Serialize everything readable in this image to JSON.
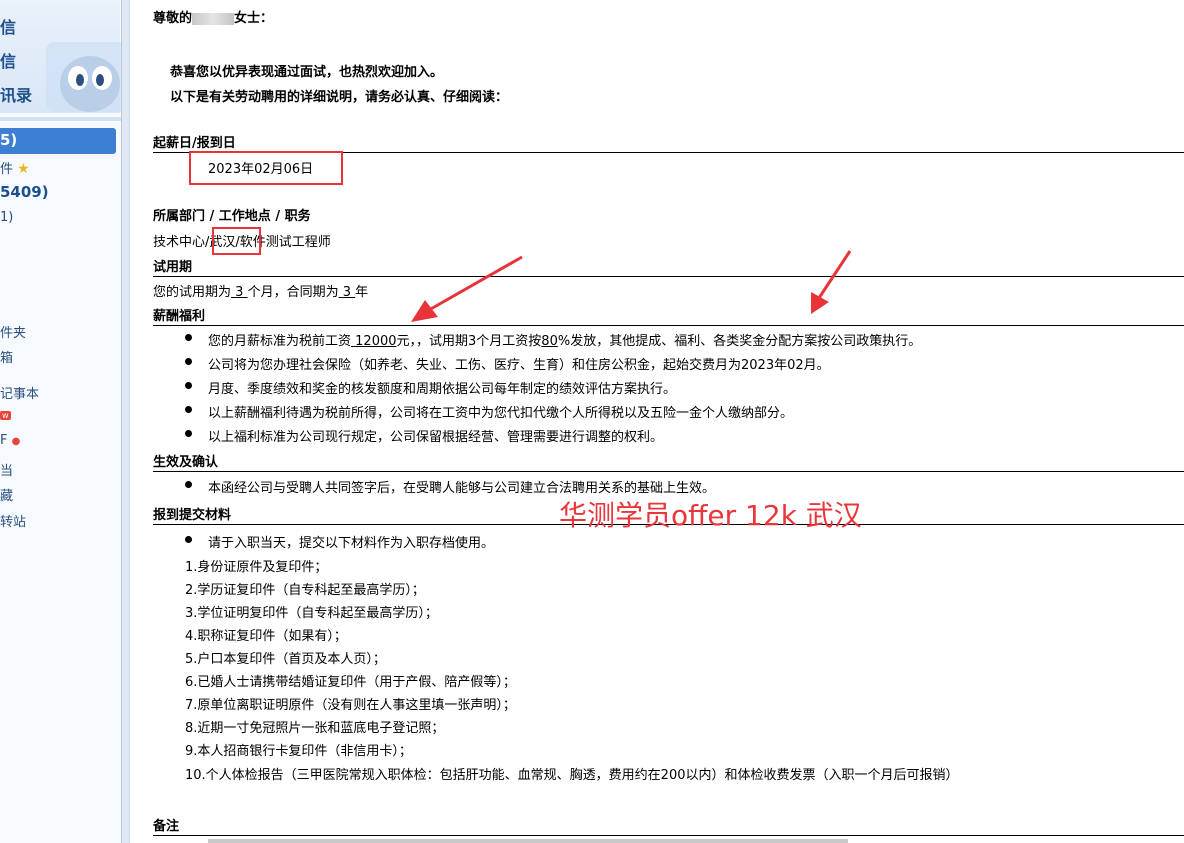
{
  "sidebar": {
    "top_links": [
      "信",
      "信",
      "讯录"
    ],
    "inbox_count": "5)",
    "starred_label": "件",
    "other_count": "5409)",
    "other_small": "1)",
    "items": [
      "件夹",
      "箱",
      "记事本",
      "",
      "F",
      "当",
      "藏",
      "转站"
    ],
    "new_badge": "w"
  },
  "letter": {
    "greeting_prefix": "尊敬的",
    "greeting_suffix": "女士：",
    "intro1": "恭喜您以优异表现通过面试，也热烈欢迎加入。",
    "intro2": "以下是有关劳动聘用的详细说明，请务必认真、仔细阅读：",
    "start_date_heading": "起薪日/报到日",
    "start_date": "2023年02月06日",
    "dept_heading": "所属部门 / 工作地点 / 职务",
    "dept_part1": "技术中心/",
    "dept_location": "武汉/",
    "dept_part2": "软件测试工程师",
    "probation_heading": "试用期",
    "probation_text_a": "您的试用期为",
    "probation_months": "3",
    "probation_text_b": "个月，合同期为",
    "contract_years": "3",
    "probation_text_c": "年",
    "salary_heading": "薪酬福利",
    "salary_items": [
      {
        "a": "您的月薪标准为税前工资",
        "amount": "12000",
        "b": "元，，试用期3个月工资按",
        "pct": "80",
        "c": "%发放，其他提成、福利、各类奖金分配方案按公司政策执行。"
      },
      {
        "a": "公司将为您办理社会保险（如养老、失业、工伤、医疗、生育）和住房公积金，起始交费月为2023年02月。"
      },
      {
        "a": "月度、季度绩效和奖金的核发额度和周期依据公司每年制定的绩效评估方案执行。"
      },
      {
        "a": "以上薪酬福利待遇为税前所得，公司将在工资中为您代扣代缴个人所得税以及五险一金个人缴纳部分。"
      },
      {
        "a": "以上福利标准为公司现行规定，公司保留根据经营、管理需要进行调整的权利。"
      }
    ],
    "effect_heading": "生效及确认",
    "effect_item": "本函经公司与受聘人共同签字后，在受聘人能够与公司建立合法聘用关系的基础上生效。",
    "materials_heading": "报到提交材料",
    "materials_intro": "请于入职当天，提交以下材料作为入职存档使用。",
    "materials": [
      "1.身份证原件及复印件；",
      "2.学历证复印件（自专科起至最高学历）；",
      "3.学位证明复印件（自专科起至最高学历）；",
      "4.职称证复印件（如果有）；",
      "5.户口本复印件（首页及本人页）；",
      "6.已婚人士请携带结婚证复印件（用于产假、陪产假等）；",
      "7.原单位离职证明原件（没有则在人事这里填一张声明）；",
      "8.近期一寸免冠照片一张和蓝底电子登记照；",
      "9.本人招商银行卡复印件（非信用卡）；",
      "10.个人体检报告（三甲医院常规入职体检：包括肝功能、血常规、胸透，费用约在200以内）和体检收费发票（入职一个月后可报销）"
    ],
    "notes_heading": "备注"
  },
  "overlay": {
    "text": "华测学员offer  12k  武汉"
  },
  "colors": {
    "accent": "#e8333b",
    "sidebar_active": "#3d7fd3",
    "link": "#1d4f8c"
  }
}
